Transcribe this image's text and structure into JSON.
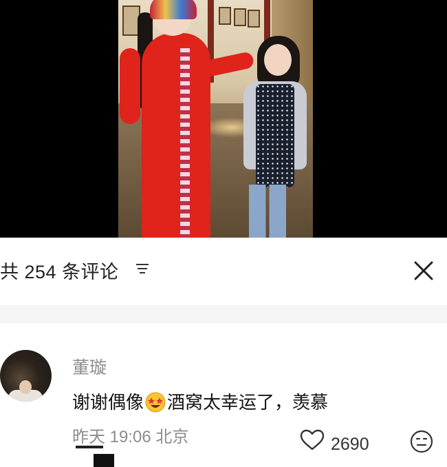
{
  "comments_panel": {
    "count_label": "共 254 条评论",
    "sort_icon": "sort-lines-icon",
    "close_icon": "close-x-icon"
  },
  "comment": {
    "username": "董璇",
    "text_before_emoji": "谢谢偶像",
    "emoji": "star-struck-emoji",
    "text_after_emoji": "酒窝太幸运了，羡慕",
    "time": "昨天 19:06",
    "location": "北京",
    "likes": "2690",
    "like_icon": "heart-outline-icon",
    "react_icon": "neutral-face-icon"
  },
  "colors": {
    "costume_red": "#e0231b",
    "meta_gray": "#8c8c8c",
    "text_dark": "#161616"
  }
}
